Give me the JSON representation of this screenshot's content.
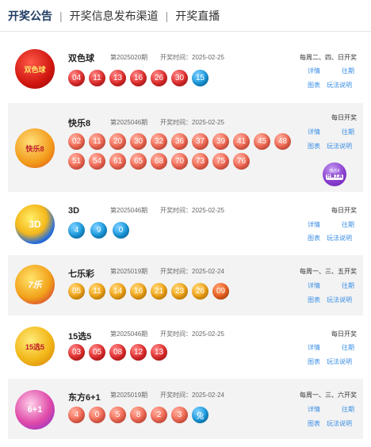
{
  "tabs": [
    "开奖公告",
    "开奖信息发布渠道",
    "开奖直播"
  ],
  "links": {
    "detail": "详情",
    "past": "往期",
    "chart": "图表",
    "rules": "玩法说明"
  },
  "lotteries": [
    {
      "name": "双色球",
      "issue": "第2025020期",
      "draw_time": "开奖时间：2025-02-25",
      "freq": "每周二、四、日开奖",
      "balls": [
        "04",
        "11",
        "13",
        "16",
        "26",
        "30",
        "15"
      ],
      "colors": [
        "red",
        "red",
        "red",
        "red",
        "red",
        "red",
        "blue"
      ],
      "logo_text": "双色球"
    },
    {
      "name": "快乐8",
      "issue": "第2025046期",
      "draw_time": "开奖时间：2025-02-25",
      "freq": "每日开奖",
      "balls": [
        "02",
        "11",
        "20",
        "30",
        "32",
        "36",
        "37",
        "39",
        "41",
        "45",
        "48",
        "51",
        "54",
        "61",
        "65",
        "68",
        "70",
        "73",
        "75",
        "76"
      ],
      "colors": [
        "lred",
        "lred",
        "lred",
        "lred",
        "lred",
        "lred",
        "lred",
        "lred",
        "lred",
        "lred",
        "lred",
        "lred",
        "lred",
        "lred",
        "lred",
        "lred",
        "lred",
        "lred",
        "lred",
        "lred"
      ],
      "tool": [
        "快乐8",
        "计算工具"
      ],
      "logo_text": "快乐8"
    },
    {
      "name": "3D",
      "issue": "第2025046期",
      "draw_time": "开奖时间：2025-02-25",
      "freq": "每日开奖",
      "balls": [
        "4",
        "9",
        "0"
      ],
      "colors": [
        "blue",
        "blue",
        "blue"
      ],
      "logo_text": "3D"
    },
    {
      "name": "七乐彩",
      "issue": "第2025019期",
      "draw_time": "开奖时间：2025-02-24",
      "freq": "每周一、三、五开奖",
      "balls": [
        "05",
        "11",
        "14",
        "16",
        "21",
        "23",
        "26",
        "09"
      ],
      "colors": [
        "orange",
        "orange",
        "orange",
        "orange",
        "orange",
        "orange",
        "orange",
        "dorange"
      ],
      "logo_text": "7乐"
    },
    {
      "name": "15选5",
      "issue": "第2025046期",
      "draw_time": "开奖时间：2025-02-25",
      "freq": "每日开奖",
      "balls": [
        "03",
        "05",
        "08",
        "12",
        "13"
      ],
      "colors": [
        "red",
        "red",
        "red",
        "red",
        "red"
      ],
      "logo_text": "15选5"
    },
    {
      "name": "东方6+1",
      "issue": "第2025019期",
      "draw_time": "开奖时间：2025-02-24",
      "freq": "每周一、三、六开奖",
      "balls": [
        "4",
        "0",
        "5",
        "8",
        "2",
        "3",
        "兔"
      ],
      "colors": [
        "lred",
        "lred",
        "lred",
        "lred",
        "lred",
        "lred",
        "blue"
      ],
      "logo_text": "6+1"
    }
  ]
}
